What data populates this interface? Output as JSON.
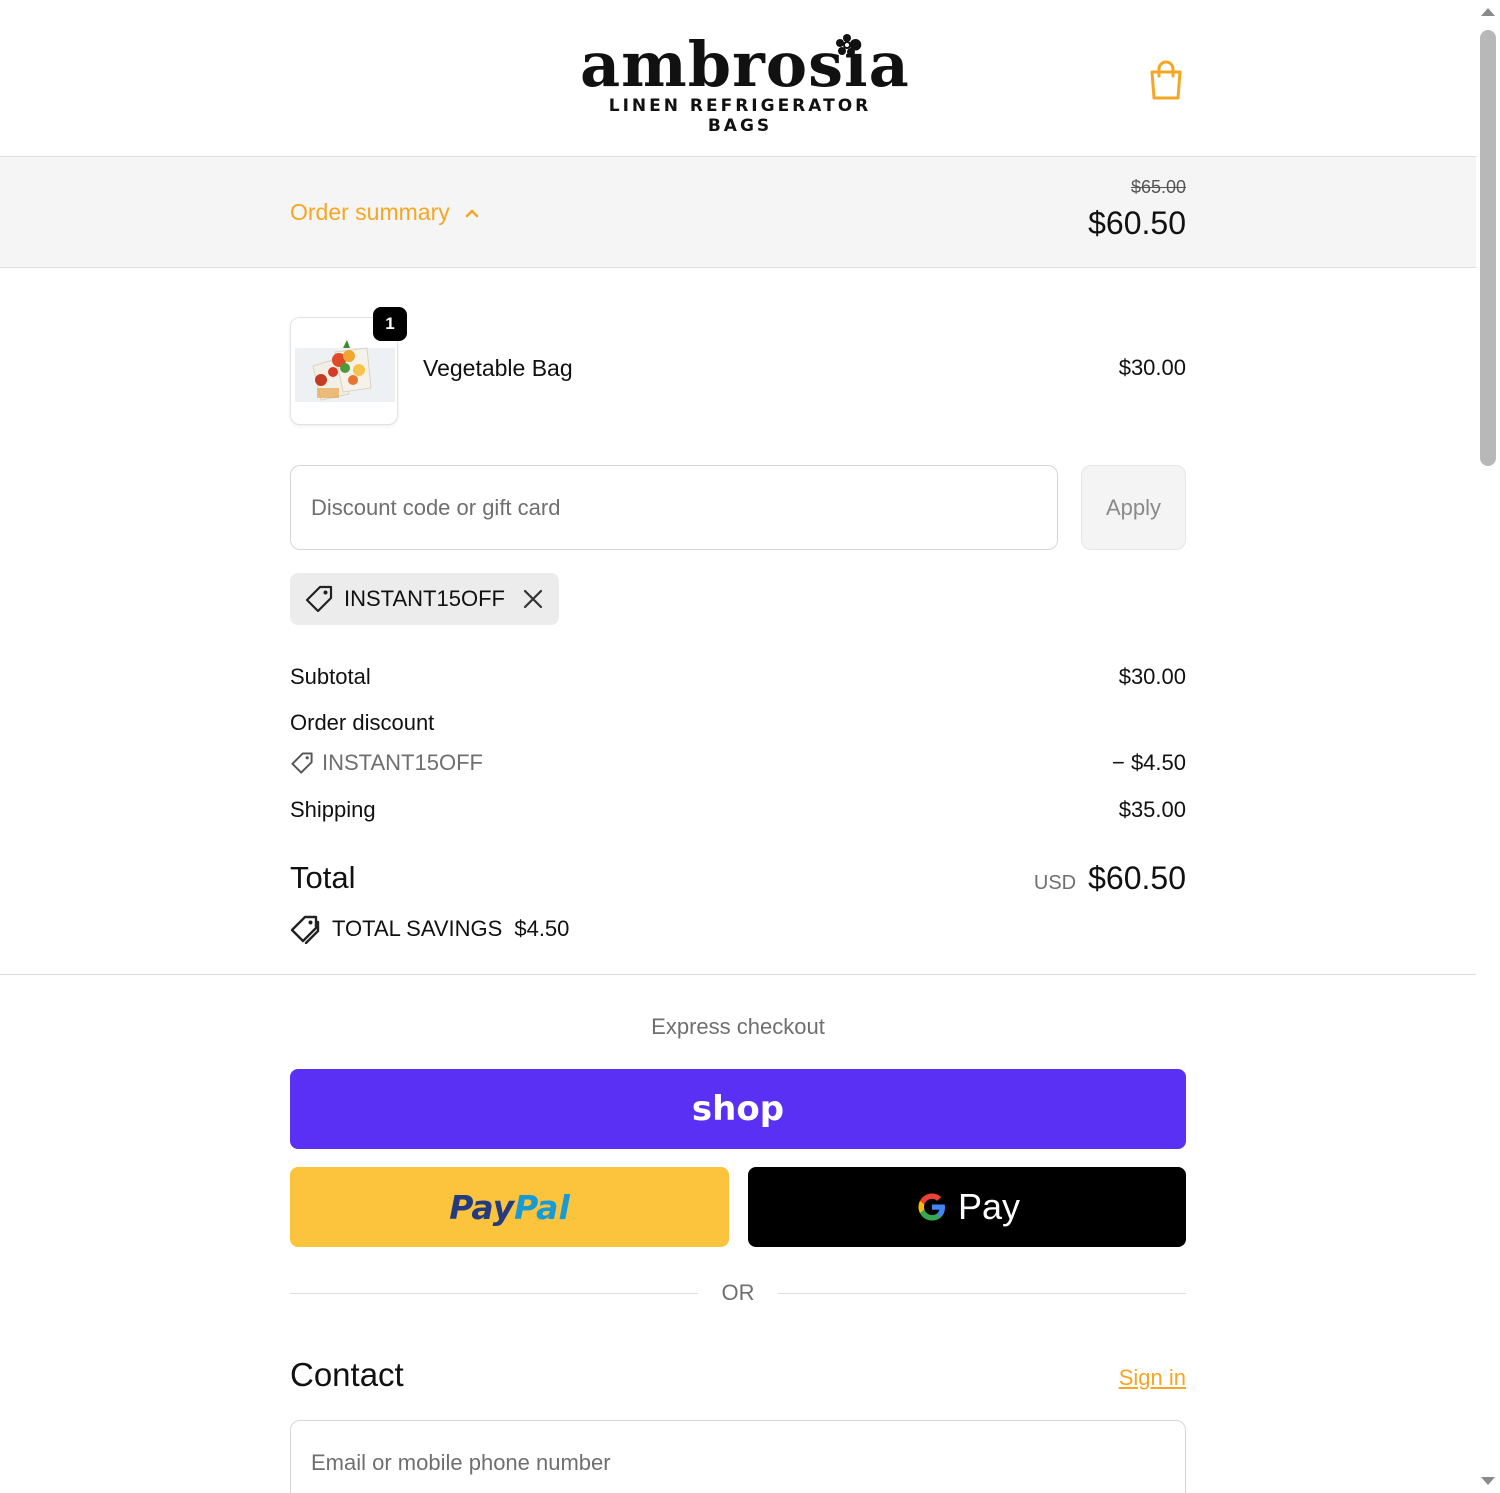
{
  "brand": {
    "name": "ambrosia",
    "tagline": "LINEN REFRIGERATOR BAGS",
    "accent_color": "#f5a623"
  },
  "summary": {
    "toggle_label": "Order summary",
    "original_total": "$65.00",
    "total": "$60.50"
  },
  "line_items": [
    {
      "name": "Vegetable Bag",
      "quantity": "1",
      "price": "$30.00"
    }
  ],
  "discount": {
    "placeholder": "Discount code or gift card",
    "apply_label": "Apply",
    "applied_code": "INSTANT15OFF"
  },
  "totals": {
    "subtotal_label": "Subtotal",
    "subtotal_value": "$30.00",
    "order_discount_label": "Order discount",
    "discount_code": "INSTANT15OFF",
    "discount_value": "− $4.50",
    "shipping_label": "Shipping",
    "shipping_value": "$35.00",
    "total_label": "Total",
    "currency": "USD",
    "total_value": "$60.50",
    "savings_label": "TOTAL SAVINGS",
    "savings_value": "$4.50"
  },
  "express": {
    "title": "Express checkout",
    "shop_label": "shop",
    "paypal_label_1": "Pay",
    "paypal_label_2": "Pal",
    "gpay_label": "Pay",
    "shop_color": "#5a31f4",
    "paypal_color": "#fcc43c",
    "gpay_color": "#000000",
    "or_label": "OR"
  },
  "contact": {
    "title": "Contact",
    "sign_in_label": "Sign in",
    "email_placeholder": "Email or mobile phone number"
  }
}
